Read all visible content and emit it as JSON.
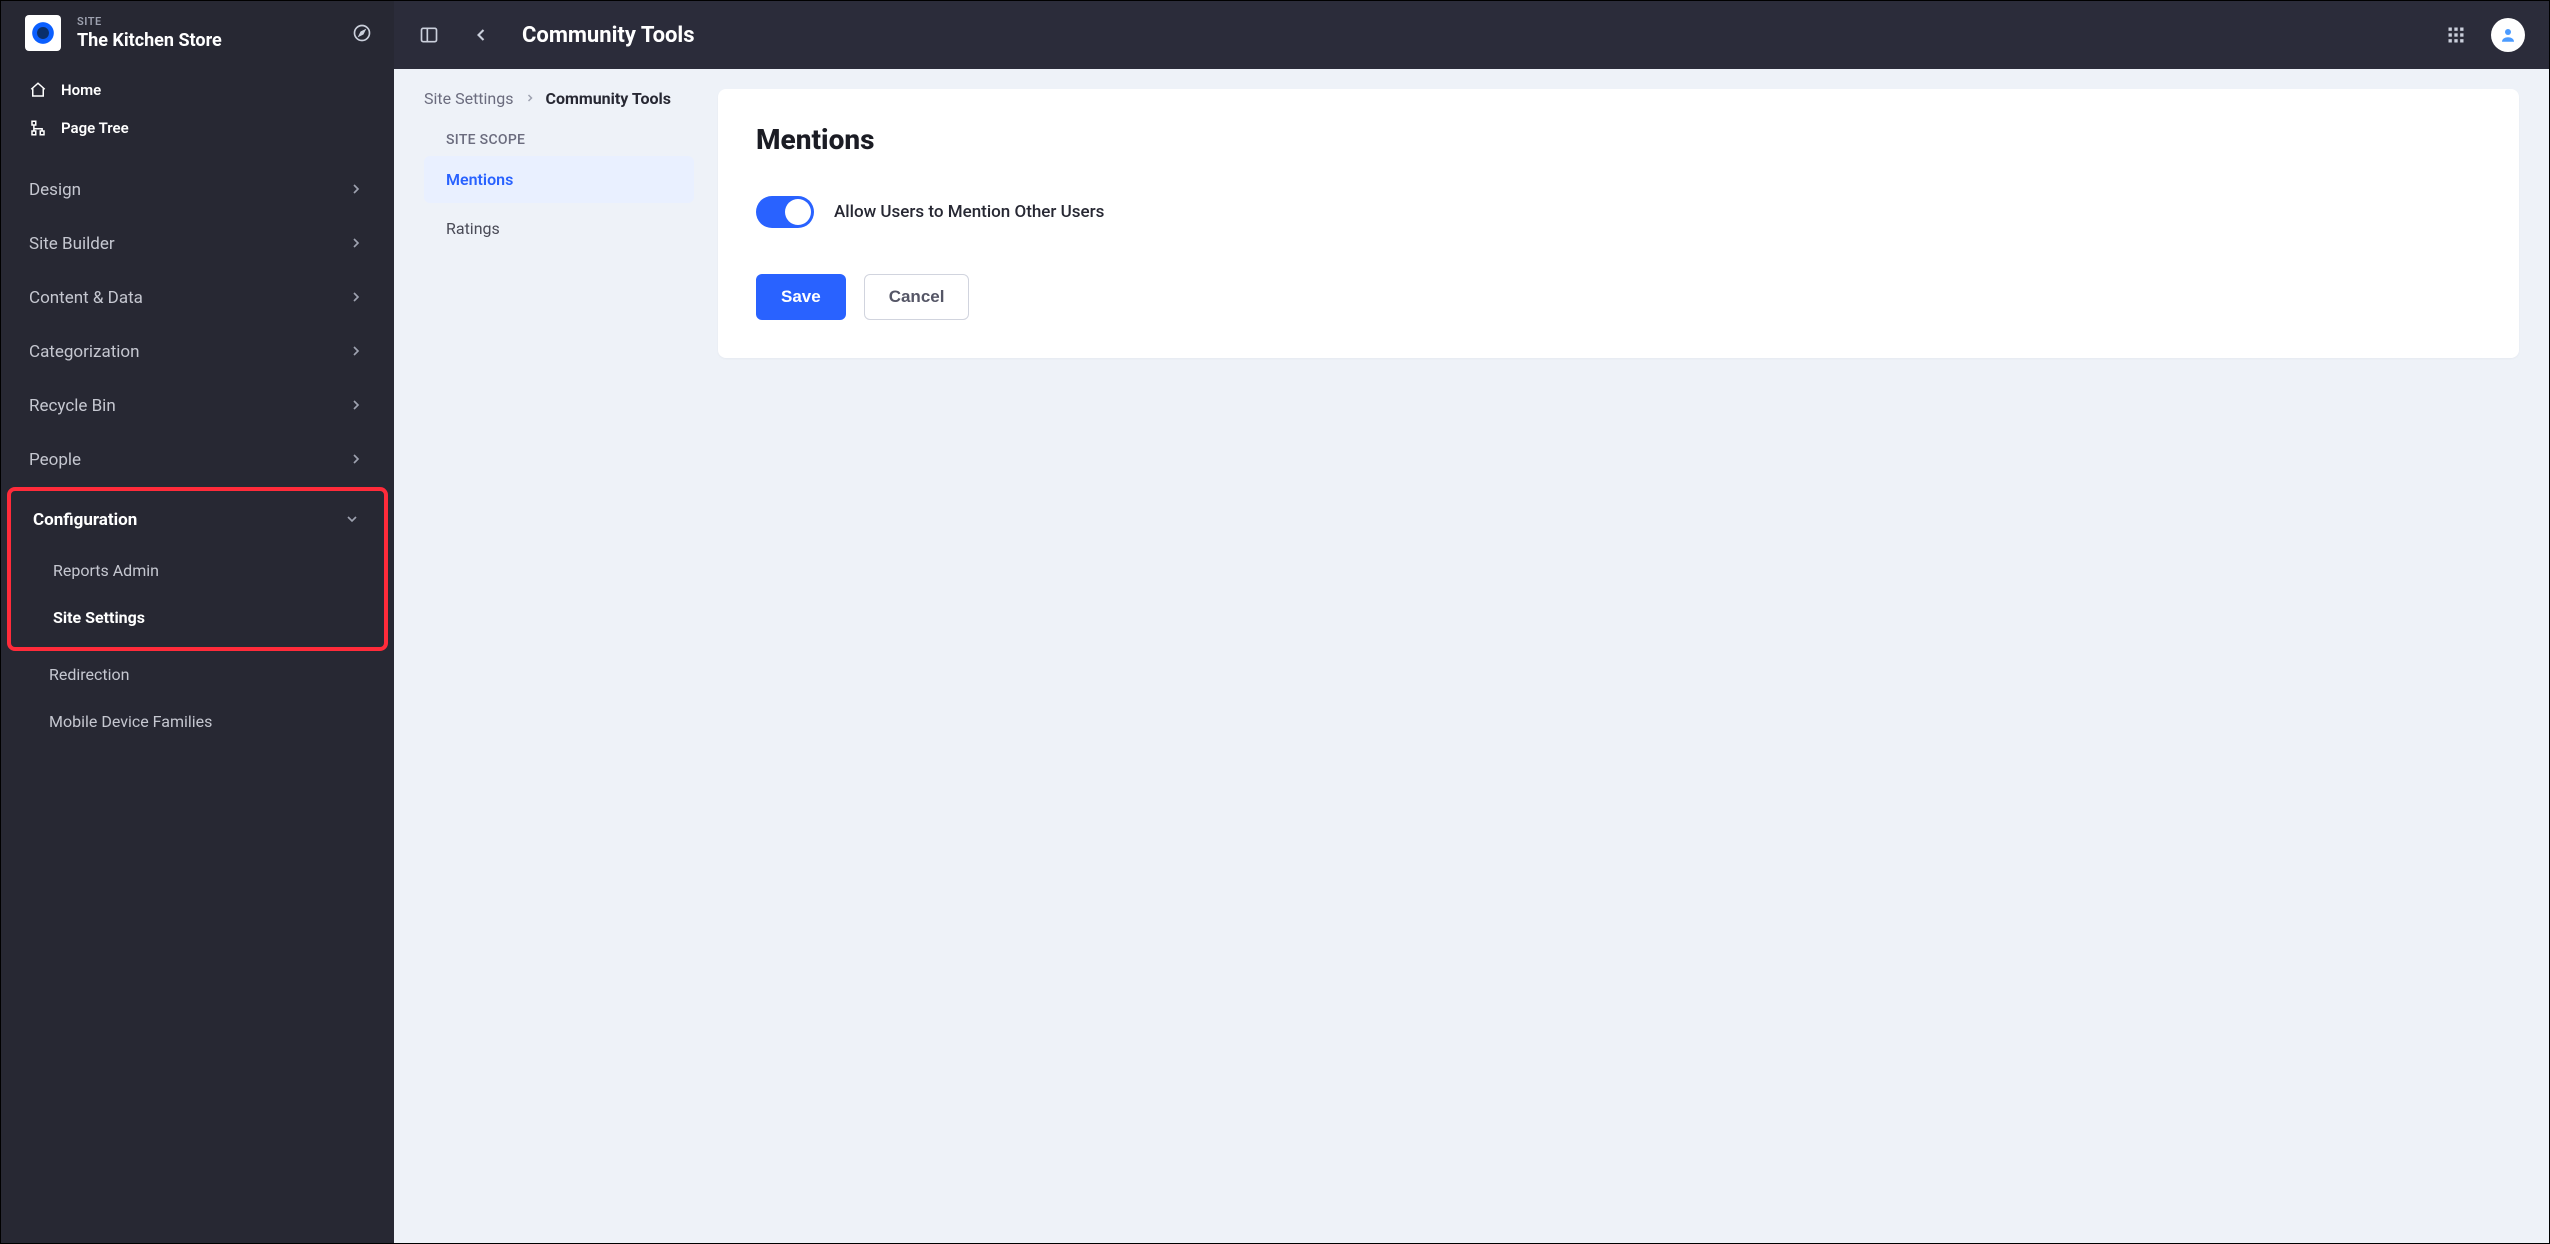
{
  "sidebar": {
    "eyebrow": "SITE",
    "title": "The Kitchen Store",
    "home": "Home",
    "page_tree": "Page Tree",
    "items": [
      {
        "label": "Design"
      },
      {
        "label": "Site Builder"
      },
      {
        "label": "Content & Data"
      },
      {
        "label": "Categorization"
      },
      {
        "label": "Recycle Bin"
      },
      {
        "label": "People"
      },
      {
        "label": "Configuration"
      }
    ],
    "config_children": [
      {
        "label": "Reports Admin"
      },
      {
        "label": "Site Settings"
      },
      {
        "label": "Redirection"
      },
      {
        "label": "Mobile Device Families"
      }
    ]
  },
  "topbar": {
    "title": "Community Tools"
  },
  "breadcrumb": {
    "parent": "Site Settings",
    "current": "Community Tools"
  },
  "scope": {
    "heading": "SITE SCOPE",
    "items": [
      {
        "label": "Mentions"
      },
      {
        "label": "Ratings"
      }
    ]
  },
  "card": {
    "title": "Mentions",
    "toggle_label": "Allow Users to Mention Other Users",
    "save": "Save",
    "cancel": "Cancel"
  }
}
